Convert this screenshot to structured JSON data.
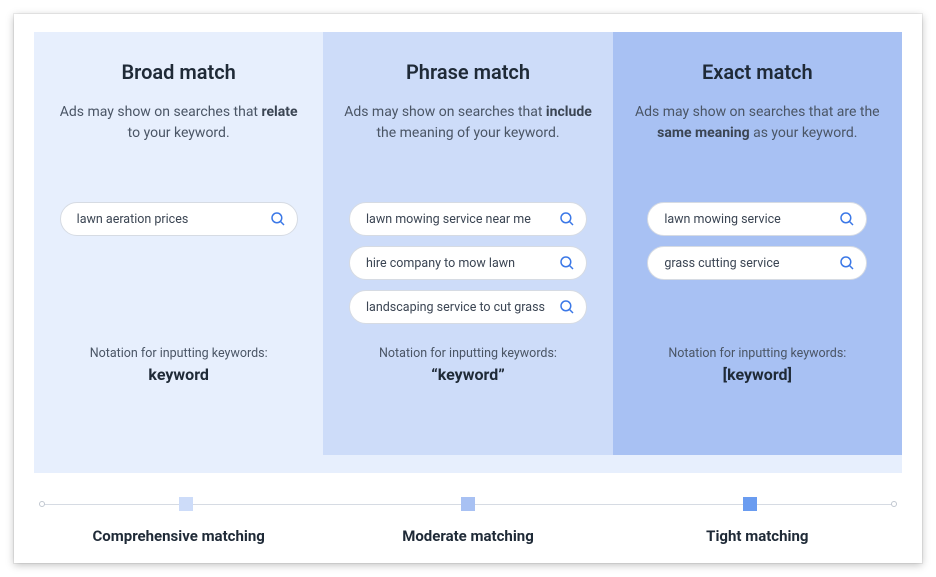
{
  "columns": {
    "broad": {
      "title": "Broad match",
      "desc_pre": "Ads may show on searches that ",
      "desc_bold": "relate",
      "desc_post": " to your keyword.",
      "searches": [
        "lawn aeration prices"
      ],
      "notation_label": "Notation for inputting keywords:",
      "notation_value": "keyword"
    },
    "phrase": {
      "title": "Phrase match",
      "desc_pre": "Ads may show on searches that ",
      "desc_bold": "include",
      "desc_post": " the meaning of your keyword.",
      "searches": [
        "lawn mowing service near me",
        "hire company to mow lawn",
        "landscaping service to cut grass"
      ],
      "notation_label": "Notation for inputting keywords:",
      "notation_value": "“keyword”"
    },
    "exact": {
      "title": "Exact match",
      "desc_pre": "Ads may show on searches that are the ",
      "desc_bold": "same meaning",
      "desc_post": " as your keyword.",
      "searches": [
        "lawn mowing service",
        "grass cutting service"
      ],
      "notation_label": "Notation for inputting keywords:",
      "notation_value": "[keyword]"
    }
  },
  "scale": {
    "labels": [
      "Comprehensive matching",
      "Moderate matching",
      "Tight matching"
    ]
  }
}
